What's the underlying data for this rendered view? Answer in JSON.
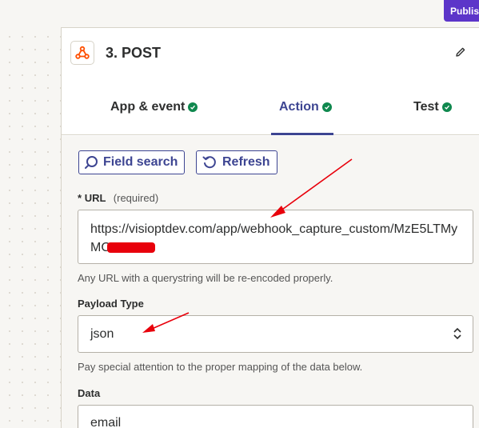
{
  "publish_label": "Publis",
  "step": {
    "title": "3. POST",
    "app_icon": "webhook-icon"
  },
  "tabs": [
    {
      "label": "App & event",
      "status": "complete"
    },
    {
      "label": "Action",
      "status": "complete",
      "active": true
    },
    {
      "label": "Test",
      "status": "complete"
    }
  ],
  "toolbar": {
    "field_search_label": "Field search",
    "refresh_label": "Refresh"
  },
  "url_field": {
    "label": "URL",
    "required_marker": "*",
    "required_text": "(required)",
    "value": "https://visioptdev.com/app/webhook_capture_custom/MzE5LTMyMC",
    "help": "Any URL with a querystring will be re-encoded properly."
  },
  "payload_field": {
    "label": "Payload Type",
    "value": "json",
    "help": "Pay special attention to the proper mapping of the data below."
  },
  "data_field": {
    "label": "Data",
    "first_key": "email"
  },
  "colors": {
    "accent": "#3d4592",
    "publish": "#5c35c9",
    "success": "#0f884e",
    "annotation": "#e8000b"
  }
}
